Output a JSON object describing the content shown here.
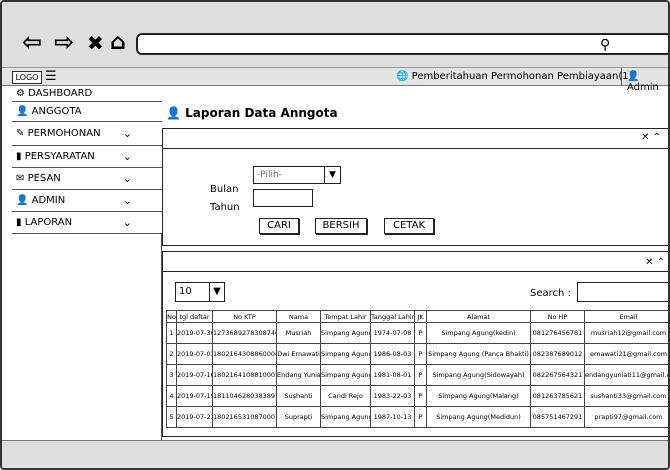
{
  "app": {
    "logo": "LOGO",
    "notification": "Pemberitahuan Permohonan Pembiayaan(1)",
    "user": "Admin"
  },
  "sidebar": {
    "items": [
      {
        "label": "DASHBOARD",
        "icon": "dashboard-icon",
        "chevron": false
      },
      {
        "label": "ANGGOTA",
        "icon": "user-icon",
        "chevron": false
      },
      {
        "label": "PERMOHONAN",
        "icon": "edit-icon",
        "chevron": true
      },
      {
        "label": "PERSYARATAN",
        "icon": "document-icon",
        "chevron": true
      },
      {
        "label": "PESAN",
        "icon": "envelope-icon",
        "chevron": true
      },
      {
        "label": "ADMIN",
        "icon": "user-icon",
        "chevron": true
      },
      {
        "label": "LAPORAN",
        "icon": "document-icon",
        "chevron": true
      }
    ]
  },
  "page": {
    "title": "Laporan Data Anngota"
  },
  "filter": {
    "bulan_label": "Bulan",
    "bulan_value": "-Pilih-",
    "tahun_label": "Tahun",
    "tahun_value": "",
    "cari": "CARI",
    "bersih": "BERSIH",
    "cetak": "CETAK"
  },
  "tablepanel": {
    "page_size": "10",
    "search_label": "Search :",
    "search_value": ""
  },
  "table": {
    "headers": [
      "No",
      "tgl daftar",
      "No KTP",
      "Nama",
      "Tempat Lahir",
      "Tanggal Lahir",
      "JK",
      "Alamat",
      "No HP",
      "Email"
    ],
    "rows": [
      [
        "1",
        "2019-07-30",
        "1273689278308746",
        "Musriah",
        "Simpang Agung",
        "1974-07-08",
        "P",
        "Simpang Agung(kedin)",
        "081276456781",
        "musriah12@gmail.com"
      ],
      [
        "2",
        "2019-07-03",
        "1802164308860004",
        "Dwi Ernawati",
        "Simpang Agung",
        "1986-08-03",
        "P",
        "Simpang Agung (Panca Bhakti)",
        "082387689012",
        "ernawati21@gmail.com"
      ],
      [
        "3",
        "2019-07-16",
        "1802164108810001",
        "Endang Yuniati",
        "Simpang Agung",
        "1981-08-01",
        "P",
        "Simpang Agung(Sidowayah)",
        "082267564321",
        "endangyuniati11@gmail.com"
      ],
      [
        "4",
        "2019-07-19",
        "1811046280383897",
        "Sushanti",
        "Candi Rejo",
        "1983-22-03",
        "P",
        "Simpang Agung(Malang)",
        "081263785621",
        "sushanti33@gmail.com"
      ],
      [
        "5",
        "2019-07-21",
        "1802165310870007",
        "Suprapti",
        "Simpang Agung",
        "1987-10-13",
        "P",
        "Simpang Agung(Medidun)",
        "085751467291",
        "prapti97@gmail.com"
      ]
    ]
  }
}
